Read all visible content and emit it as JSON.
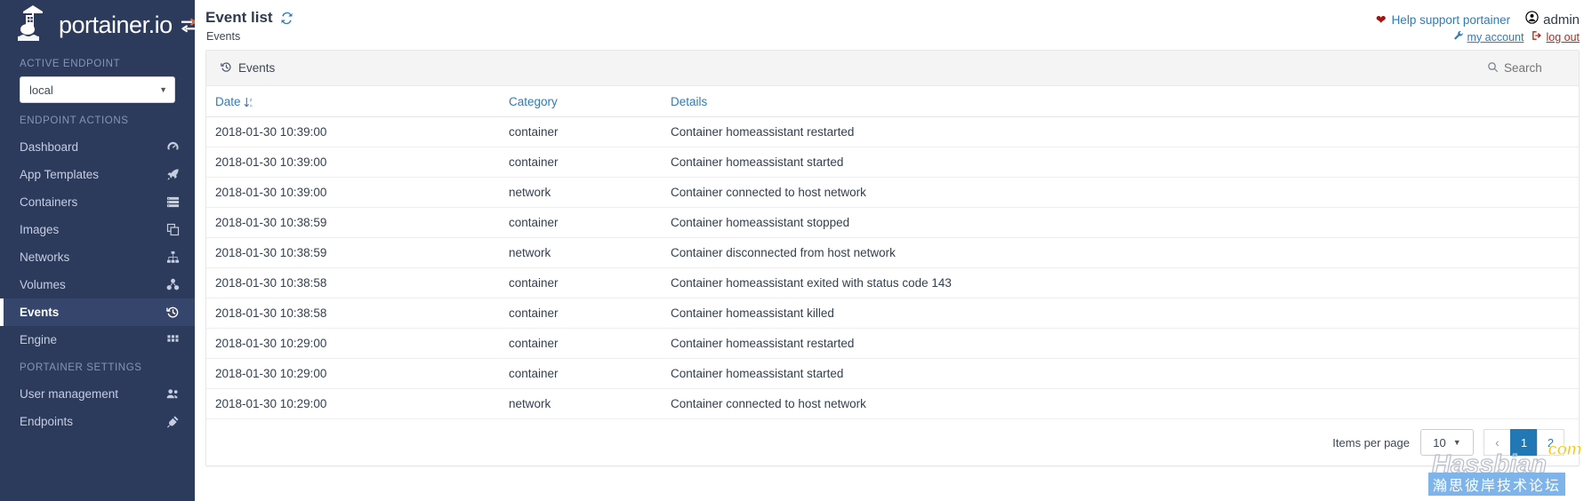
{
  "brand": {
    "name": "portainer.io",
    "logo_icon": "portainer-whale-logo",
    "toggle_icon": "sidebar-toggle-icon"
  },
  "sidebar": {
    "sections": [
      {
        "title": "ACTIVE ENDPOINT"
      },
      {
        "title": "ENDPOINT ACTIONS"
      },
      {
        "title": "PORTAINER SETTINGS"
      }
    ],
    "endpoint_select": {
      "value": "local",
      "caret_icon": "chevron-down-icon"
    },
    "endpoint_actions": [
      {
        "label": "Dashboard",
        "icon": "tachometer-icon",
        "active": false
      },
      {
        "label": "App Templates",
        "icon": "rocket-icon",
        "active": false
      },
      {
        "label": "Containers",
        "icon": "server-list-icon",
        "active": false
      },
      {
        "label": "Images",
        "icon": "clone-icon",
        "active": false
      },
      {
        "label": "Networks",
        "icon": "sitemap-icon",
        "active": false
      },
      {
        "label": "Volumes",
        "icon": "cubes-icon",
        "active": false
      },
      {
        "label": "Events",
        "icon": "history-icon",
        "active": true
      },
      {
        "label": "Engine",
        "icon": "grid-icon",
        "active": false
      }
    ],
    "portainer_settings": [
      {
        "label": "User management",
        "icon": "users-icon",
        "active": false
      },
      {
        "label": "Endpoints",
        "icon": "plug-icon",
        "active": false
      }
    ]
  },
  "header": {
    "title": "Event list",
    "refresh_icon": "refresh-icon",
    "breadcrumb": "Events",
    "help_label": "Help support portainer",
    "heart_icon": "heart-icon",
    "user_icon": "user-circle-icon",
    "username": "admin",
    "my_account_label": "my account",
    "my_account_icon": "wrench-icon",
    "logout_label": "log out",
    "logout_icon": "sign-out-icon"
  },
  "panel": {
    "title": "Events",
    "title_icon": "history-icon",
    "search_label": "Search",
    "search_icon": "search-icon",
    "search_value": "",
    "columns": [
      {
        "key": "date",
        "label": "Date",
        "sorted": true,
        "sort_icon": "sort-alpha-desc-icon"
      },
      {
        "key": "category",
        "label": "Category",
        "sorted": false
      },
      {
        "key": "details",
        "label": "Details",
        "sorted": false
      }
    ],
    "rows": [
      {
        "date": "2018-01-30 10:39:00",
        "category": "container",
        "details": "Container homeassistant restarted"
      },
      {
        "date": "2018-01-30 10:39:00",
        "category": "container",
        "details": "Container homeassistant started"
      },
      {
        "date": "2018-01-30 10:39:00",
        "category": "network",
        "details": "Container connected to host network"
      },
      {
        "date": "2018-01-30 10:38:59",
        "category": "container",
        "details": "Container homeassistant stopped"
      },
      {
        "date": "2018-01-30 10:38:59",
        "category": "network",
        "details": "Container disconnected from host network"
      },
      {
        "date": "2018-01-30 10:38:58",
        "category": "container",
        "details": "Container homeassistant exited with status code 143"
      },
      {
        "date": "2018-01-30 10:38:58",
        "category": "container",
        "details": "Container homeassistant killed"
      },
      {
        "date": "2018-01-30 10:29:00",
        "category": "container",
        "details": "Container homeassistant restarted"
      },
      {
        "date": "2018-01-30 10:29:00",
        "category": "container",
        "details": "Container homeassistant started"
      },
      {
        "date": "2018-01-30 10:29:00",
        "category": "network",
        "details": "Container connected to host network"
      }
    ],
    "footer": {
      "items_per_page_label": "Items per page",
      "items_per_page_value": "10",
      "caret_icon": "chevron-down-icon",
      "prev_label": "‹",
      "pages": [
        {
          "label": "1",
          "active": true
        },
        {
          "label": "2",
          "active": false
        }
      ]
    }
  },
  "watermark": {
    "main": "Hassbian",
    "tld": "com",
    "chinese": "瀚思彼岸技术论坛"
  },
  "colors": {
    "sidebar_bg": "#2c3a5c",
    "sidebar_active": "#36456b",
    "link_blue": "#337ab7",
    "pager_active": "#2277b5",
    "logout_red": "#b02a1e",
    "heart_red": "#a31515"
  }
}
